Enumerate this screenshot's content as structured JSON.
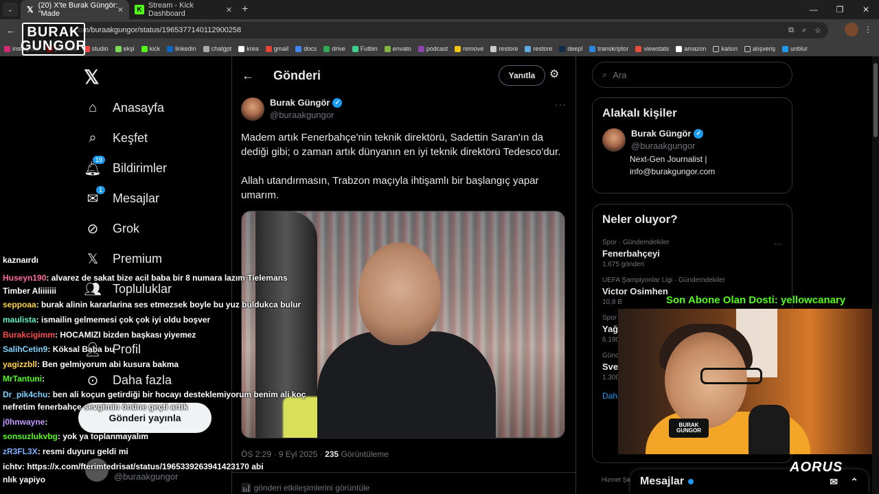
{
  "browser": {
    "tabs": [
      {
        "title": "(20) X'te Burak Güngör: \"Made",
        "active": true
      },
      {
        "title": "Stream - Kick Dashboard",
        "active": false
      }
    ],
    "url": "x.com/buraakgungor/status/1965377140112900258",
    "bookmarks": [
      "instagram",
      "youtube",
      "studio",
      "ekşi",
      "kick",
      "linkedin",
      "chatgpt",
      "krea",
      "gmail",
      "docs",
      "drive",
      "Futbin",
      "envato",
      "podcast",
      "remove",
      "restore",
      "restore",
      "deepl",
      "transkriptor",
      "viewstats",
      "amazon",
      "kalsın",
      "alışveriş",
      "unblur"
    ]
  },
  "overlay": {
    "logo_line1": "BURAK",
    "logo_line2": "GUNGOR",
    "subscriber_notice": "Son Abone Olan Dosti: yellowcanary",
    "brand": "AORUS",
    "cam_badge_line1": "BURAK",
    "cam_badge_line2": "GUNGOR"
  },
  "sidebar": {
    "items": [
      {
        "label": "Anasayfa",
        "icon": "home-icon"
      },
      {
        "label": "Keşfet",
        "icon": "search-icon"
      },
      {
        "label": "Bildirimler",
        "icon": "bell-icon",
        "badge": "19"
      },
      {
        "label": "Mesajlar",
        "icon": "mail-icon",
        "badge": "1"
      },
      {
        "label": "Grok",
        "icon": "grok-icon"
      },
      {
        "label": "Premium",
        "icon": "x-icon"
      },
      {
        "label": "Topluluklar",
        "icon": "people-icon"
      },
      {
        "label": "Profil",
        "icon": "person-icon"
      },
      {
        "label": "Daha fazla",
        "icon": "more-icon"
      }
    ],
    "post_button": "Gönderi yayınla",
    "account_handle": "@buraakgungor"
  },
  "main": {
    "header_title": "Gönderi",
    "reply_button": "Yanıtla",
    "author_name": "Burak Güngör",
    "author_handle": "@buraakgungor",
    "tweet_p1": "Madem artık Fenerbahçe'nin teknik direktörü, Sadettin Saran'ın da dediği gibi; o zaman artık dünyanın en iyi teknik direktörü Tedesco'dur.",
    "tweet_p2": "Allah utandırmasın, Trabzon maçıyla ihtişamlı bir başlangıç yapar umarım.",
    "time": "ÖS 2:29 · 9 Eyl 2025 ·",
    "views_count": "235",
    "views_label": "Görüntüleme",
    "engagements": "gönderi etkileşimlerini görüntüle"
  },
  "right": {
    "search_placeholder": "Ara",
    "related_title": "Alakalı kişiler",
    "related_name": "Burak Güngör",
    "related_handle": "@buraakgungor",
    "related_bio1": "Next-Gen Journalist |",
    "related_bio2": "info@burakgungor.com",
    "trends_title": "Neler oluyor?",
    "trends": [
      {
        "cat": "Spor · Gündemdekiler",
        "title": "Fenerbahçeyi",
        "count": "1.675 gönderi"
      },
      {
        "cat": "UEFA Şampiyonlar Ligi · Gündemdekiler",
        "title": "Victor Osimhen",
        "count": "10,8 B"
      },
      {
        "cat": "Spor",
        "title": "Yağı",
        "count": "6.190"
      },
      {
        "cat": "Günc",
        "title": "Sven",
        "count": "1.300"
      }
    ],
    "show_more": "Daha fa",
    "footer_hint": "Hizmet Şa",
    "messages_label": "Mesajlar"
  },
  "chat": [
    {
      "user": "",
      "text": "kaznaırdı",
      "color": "#ffffff"
    },
    {
      "user": "Huseyn190",
      "text": ": alvarez de sakat bize acil baba bir 8 numara lazım Tielemans",
      "color": "#ff6b9d"
    },
    {
      "user": "",
      "text": "Timber Aliiiiiii",
      "color": "#ffffff"
    },
    {
      "user": "seppoaa",
      "text": ": burak alinin kararlarina ses etmezsek boyle bu yuz buldukca bulur",
      "color": "#ffd23f"
    },
    {
      "user": "maulista",
      "text": ": ismailin gelmemesi çok çok iyi oldu boşver",
      "color": "#5ef2c8"
    },
    {
      "user": "Burakcigimm",
      "text": ": HOCAMIZI bizden başkası yiyemez",
      "color": "#ff4d4d"
    },
    {
      "user": "SalihCetin9",
      "text": ": Köksal Baba bu",
      "color": "#7fd3ff"
    },
    {
      "user": "yagizzbll",
      "text": ": Ben gelmiyorum abi kusura bakma",
      "color": "#ffd23f"
    },
    {
      "user": "MrTantuni",
      "text": ":",
      "color": "#53fc18"
    },
    {
      "user": "Dr_pik4chu",
      "text": ": ben ali koçun getirdiği bir hocayı desteklemiyorum benim ali koç",
      "color": "#7fd3ff"
    },
    {
      "user": "",
      "text": "nefretim fenerbahçe sevgimin önüne geçti artık",
      "color": "#ffffff"
    },
    {
      "user": "j0hnwayne",
      "text": ":",
      "color": "#c59bff"
    },
    {
      "user": "sonsuzlukvbg",
      "text": ": yok ya toplanmayalım",
      "color": "#53fc18"
    },
    {
      "user": "zR3FL3X",
      "text": ": resmi duyuru geldi mi",
      "color": "#7fb0ff"
    },
    {
      "user": "ichtv",
      "text": ": https://x.com/fterimtedrisat/status/1965339263941423170 abi",
      "color": "#ffffff"
    },
    {
      "user": "",
      "text": "nlık yapiyo",
      "color": "#ffffff"
    }
  ]
}
